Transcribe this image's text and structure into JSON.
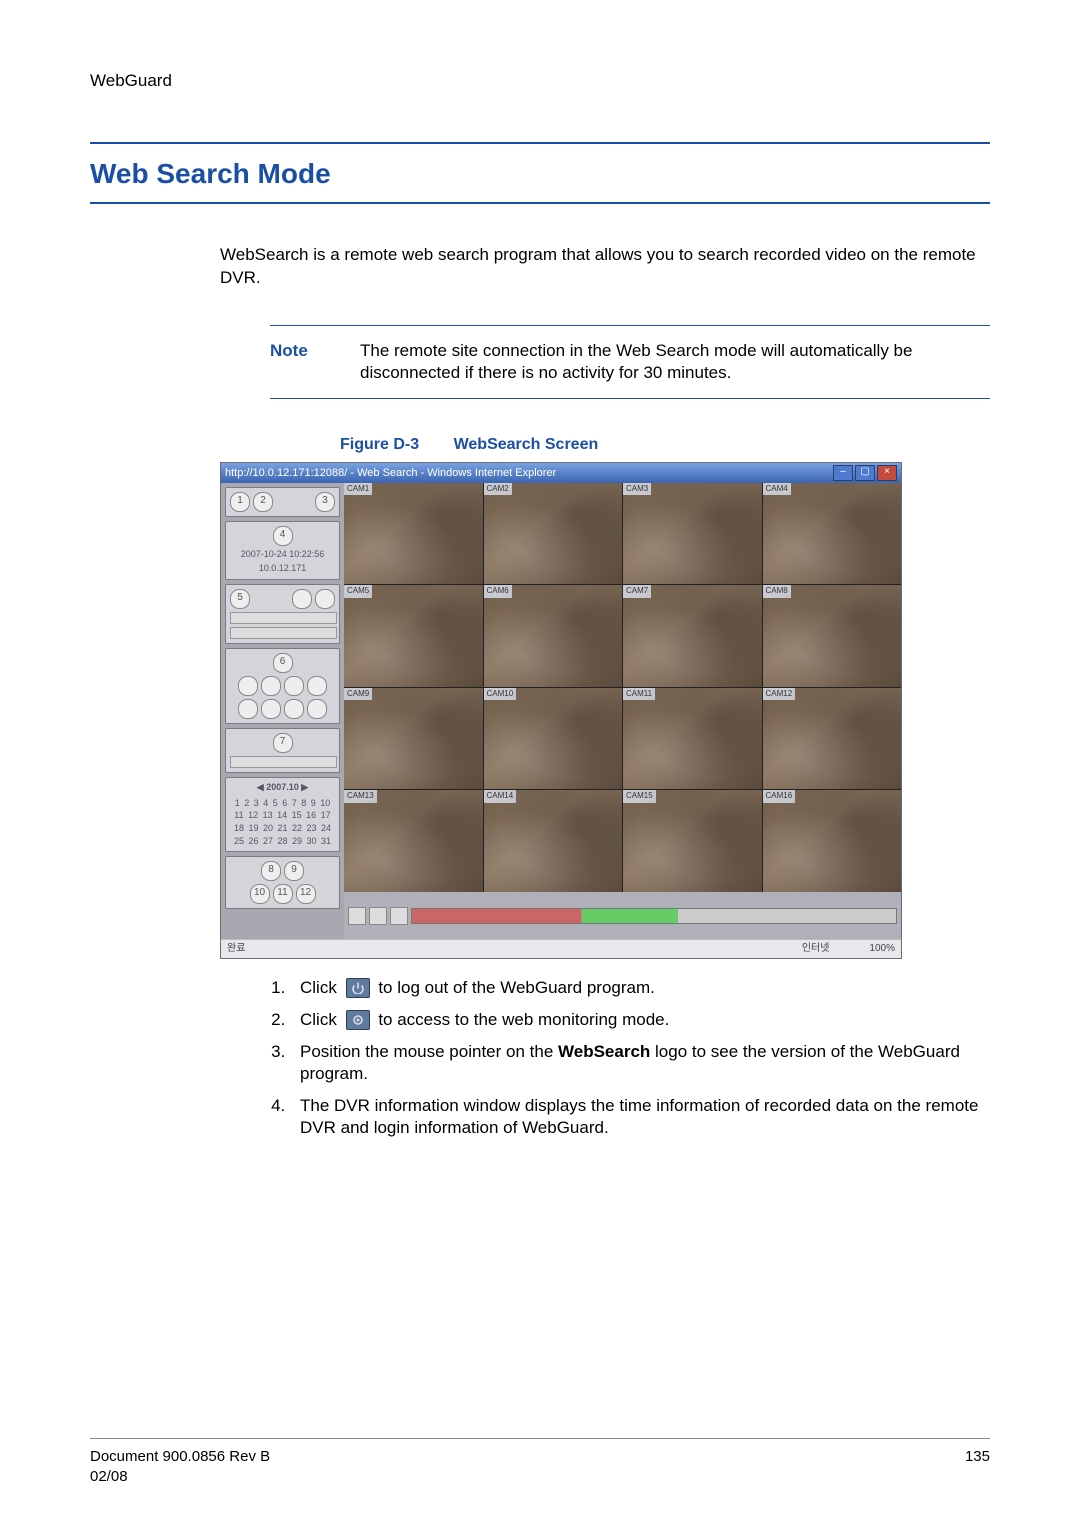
{
  "header": {
    "title": "WebGuard"
  },
  "section": {
    "title": "Web Search Mode",
    "intro": "WebSearch is a remote web search program that allows you to search recorded video on the remote DVR."
  },
  "note": {
    "label": "Note",
    "text": "The remote site connection in the Web Search mode will automatically be disconnected if there is no activity for 30 minutes."
  },
  "figure": {
    "number": "Figure D-3",
    "title": "WebSearch Screen",
    "window_title": "http://10.0.12.171:12088/ - Web Search - Windows Internet Explorer",
    "sidebar": {
      "datetime1": "2007-10-24 10:22:56",
      "datetime2": "10.0.12.171",
      "calendar_month": "2007.10",
      "calendar_days": "1 2 3 4 5 6 7 8 9 10 11 12 13 14 15 16 17 18 19 20 21 22 23 24 25 26 27 28 29 30 31"
    },
    "cameras": [
      "CAM1",
      "CAM2",
      "CAM3",
      "CAM4",
      "CAM5",
      "CAM6",
      "CAM7",
      "CAM8",
      "CAM9",
      "CAM10",
      "CAM11",
      "CAM12",
      "CAM13",
      "CAM14",
      "CAM15",
      "CAM16"
    ],
    "status_left": "완료",
    "status_internet": "인터넷",
    "status_zoom": "100%"
  },
  "steps": {
    "s1a": "Click",
    "s1b": "to log out of the WebGuard program.",
    "s2a": "Click",
    "s2b": "to access to the web monitoring mode.",
    "s3a": "Position the mouse pointer on the ",
    "s3bold": "WebSearch",
    "s3b": " logo to see the version of the WebGuard program.",
    "s4": "The DVR information window displays the time information of recorded data on the remote DVR and login information of WebGuard."
  },
  "footer": {
    "doc": "Document 900.0856 Rev B",
    "date": "02/08",
    "page": "135"
  }
}
